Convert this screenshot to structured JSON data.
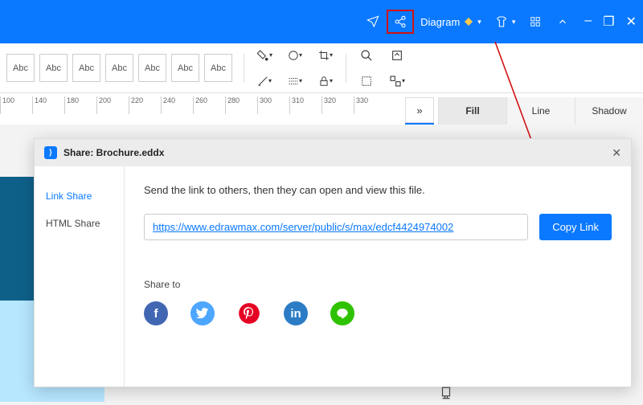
{
  "window": {
    "minimize": "–",
    "maximize": "❐",
    "close": "✕"
  },
  "titlebar": {
    "diagram_label": "Diagram"
  },
  "toolbar": {
    "abc": "Abc"
  },
  "ruler": [
    "100",
    "140",
    "180",
    "200",
    "220",
    "240",
    "260",
    "280",
    "300",
    "310",
    "320",
    "330"
  ],
  "rightpanel": {
    "chevrons": "»",
    "tabs": {
      "fill": "Fill",
      "line": "Line",
      "shadow": "Shadow"
    }
  },
  "dialog": {
    "title": "Share: Brochure.eddx",
    "sidebar": {
      "link_share": "Link Share",
      "html_share": "HTML Share"
    },
    "hint": "Send the link to others, then they can open and view this file.",
    "link": "https://www.edrawmax.com/server/public/s/max/edcf4424974002",
    "copy_btn": "Copy Link",
    "share_to": "Share to",
    "social": {
      "fb": "f",
      "tw": "",
      "pin": "",
      "li": "in",
      "line": ""
    }
  }
}
